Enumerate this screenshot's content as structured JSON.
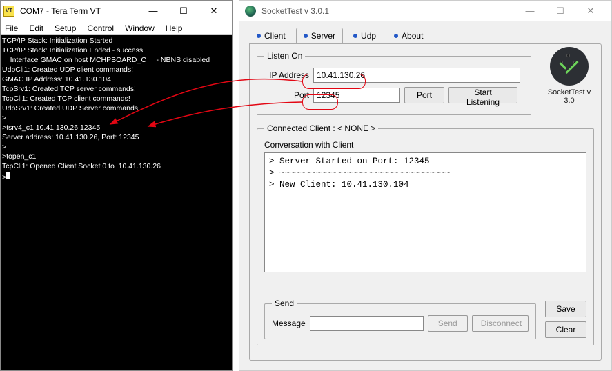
{
  "teraterm": {
    "title": "COM7 - Tera Term VT",
    "icon_label": "VT",
    "menu": [
      "File",
      "Edit",
      "Setup",
      "Control",
      "Window",
      "Help"
    ],
    "console_text": "TCP/IP Stack: Initialization Started\nTCP/IP Stack: Initialization Ended - success\n    Interface GMAC on host MCHPBOARD_C     - NBNS disabled\nUdpCli1: Created UDP client commands!\nGMAC IP Address: 10.41.130.104\nTcpSrv1: Created TCP server commands!\nTcpCli1: Created TCP client commands!\nUdpSrv1: Created UDP Server commands!\n>\n>tsrv4_c1 10.41.130.26 12345\nServer address: 10.41.130.26, Port: 12345\n>\n>topen_c1\nTcpCli1: Opened Client Socket 0 to  10.41.130.26\n>",
    "win_buttons": {
      "min": "—",
      "max": "☐",
      "close": "✕"
    }
  },
  "sockettest": {
    "title": "SocketTest v 3.0.1",
    "logo_caption": "SocketTest v 3.0",
    "tabs": [
      {
        "label": "Client",
        "active": false
      },
      {
        "label": "Server",
        "active": true
      },
      {
        "label": "Udp",
        "active": false
      },
      {
        "label": "About",
        "active": false
      }
    ],
    "listen": {
      "legend": "Listen On",
      "ip_label": "IP Address",
      "ip_value": "10.41.130.26",
      "port_label": "Port",
      "port_value": "12345",
      "port_btn": "Port",
      "start_btn": "Start Listening"
    },
    "connected": {
      "legend": "Connected Client : < NONE >",
      "convo_label": "Conversation with Client",
      "convo_text": "> Server Started on Port: 12345\n> ~~~~~~~~~~~~~~~~~~~~~~~~~~~~~~~~~\n> New Client: 10.41.130.104",
      "send_legend": "Send",
      "msg_label": "Message",
      "msg_value": "",
      "send_btn": "Send",
      "disc_btn": "Disconnect",
      "save_btn": "Save",
      "clear_btn": "Clear"
    },
    "win_buttons": {
      "min": "—",
      "max": "☐",
      "close": "✕"
    }
  }
}
